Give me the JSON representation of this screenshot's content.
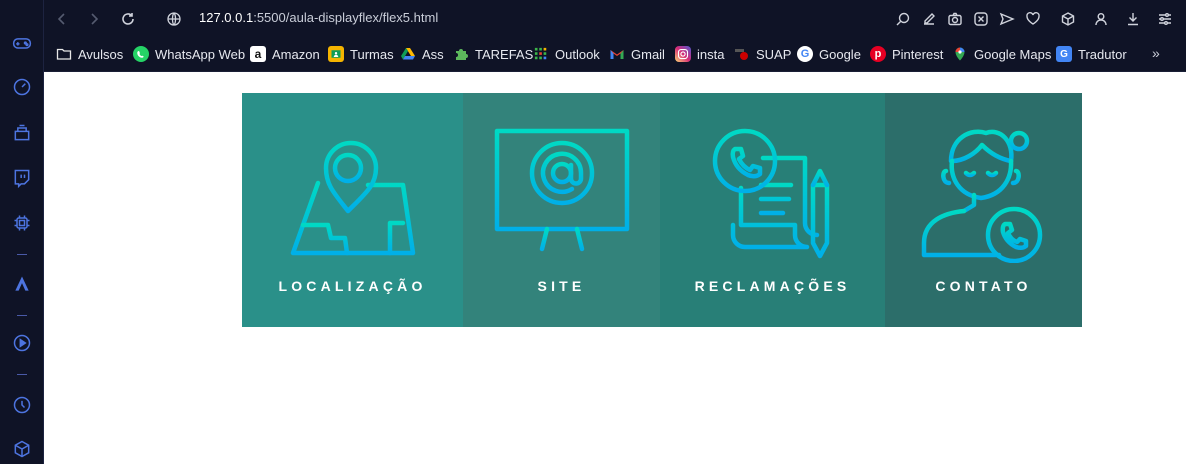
{
  "browser": {
    "url_host": "127.0.0.1",
    "url_path": ":5500/aula-displayflex/flex5.html",
    "bookmarks": [
      {
        "label": "Avulsos",
        "icon": "folder-icon",
        "color": "#e8e8e8"
      },
      {
        "label": "WhatsApp Web",
        "icon": "whatsapp-icon",
        "color": "#25d366"
      },
      {
        "label": "Amazon",
        "icon": "amazon-icon",
        "color": "#ffffff"
      },
      {
        "label": "Turmas",
        "icon": "classroom-icon",
        "color": "#f5b400"
      },
      {
        "label": "Ass",
        "icon": "drive-icon",
        "color": "#34a853"
      },
      {
        "label": "TAREFAS",
        "icon": "puzzle-icon",
        "color": "#5cb85c"
      },
      {
        "label": "Outlook",
        "icon": "grid-icon",
        "color": "#3bb54a"
      },
      {
        "label": "Gmail",
        "icon": "gmail-icon",
        "color": "#ea4335"
      },
      {
        "label": "insta",
        "icon": "instagram-icon",
        "color": "#d62976"
      },
      {
        "label": "SUAP",
        "icon": "suap-icon",
        "color": "#cc0000"
      },
      {
        "label": "Google",
        "icon": "google-icon",
        "color": "#4285f4"
      },
      {
        "label": "Pinterest",
        "icon": "pinterest-icon",
        "color": "#e60023"
      },
      {
        "label": "Google Maps",
        "icon": "maps-icon",
        "color": "#34a853"
      },
      {
        "label": "Tradutor",
        "icon": "translate-icon",
        "color": "#4285f4"
      }
    ],
    "more": "»"
  },
  "cards": [
    {
      "label": "LOCALIZAÇÃO",
      "bg": "#2a9089",
      "icon": "map-pin-icon"
    },
    {
      "label": "SITE",
      "bg": "#33837b",
      "icon": "monitor-at-icon"
    },
    {
      "label": "RECLAMAÇÕES",
      "bg": "#287f77",
      "icon": "complaint-phone-icon"
    },
    {
      "label": "CONTATO",
      "bg": "#2c6e6a",
      "icon": "contact-person-icon"
    }
  ],
  "colors": {
    "chrome_bg": "#0f1326",
    "icon_grad_top": "#00d9c4",
    "icon_grad_bottom": "#00b0e8",
    "sidebar_icon": "#4d74e0"
  }
}
